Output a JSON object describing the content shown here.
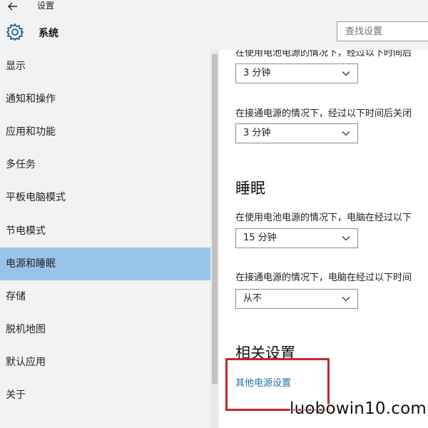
{
  "window": {
    "title": "设置"
  },
  "header": {
    "title": "系统",
    "search_placeholder": "查找设置"
  },
  "sidebar": {
    "items": [
      {
        "label": "显示"
      },
      {
        "label": "通知和操作"
      },
      {
        "label": "应用和功能"
      },
      {
        "label": "多任务"
      },
      {
        "label": "平板电脑模式"
      },
      {
        "label": "节电模式"
      },
      {
        "label": "电源和睡眠",
        "selected": true
      },
      {
        "label": "存储"
      },
      {
        "label": "脱机地图"
      },
      {
        "label": "默认应用"
      },
      {
        "label": "关于"
      }
    ]
  },
  "main": {
    "screen": {
      "battery_desc": "在使用电池电源的情况下，经过以下时间后",
      "battery_value": "3 分钟",
      "plugged_desc": "在接通电源的情况下，经过以下时间后关闭",
      "plugged_value": "3 分钟"
    },
    "sleep": {
      "title": "睡眠",
      "battery_desc": "在使用电池电源的情况下，电脑在经过以下",
      "battery_value": "15 分钟",
      "plugged_desc": "在接通电源的情况下，电脑在经过以下时间",
      "plugged_value": "从不"
    },
    "related": {
      "title": "相关设置",
      "link": "其他电源设置"
    }
  },
  "watermark": "luobowin10.com",
  "colors": {
    "selected": "#99c4e9",
    "link": "#1a73a8",
    "highlight": "#c4282e"
  }
}
